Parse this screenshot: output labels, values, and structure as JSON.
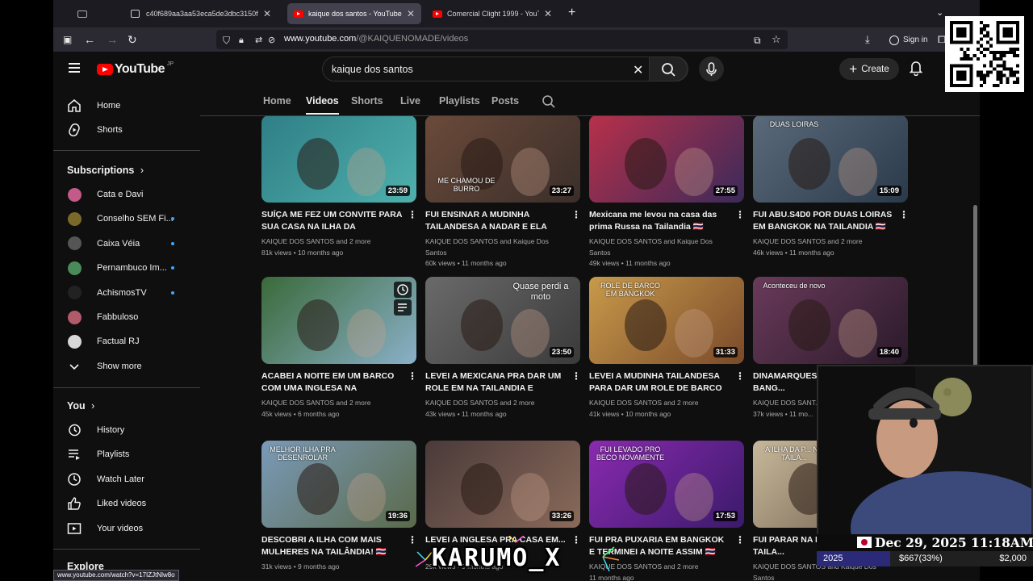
{
  "browser": {
    "tabs": [
      {
        "label": "c40f689aa3aa53eca5de3dbc3150f",
        "active": false
      },
      {
        "label": "kaique dos santos - YouTube",
        "active": true
      },
      {
        "label": "Comercial Clight 1999 - YouTub",
        "active": false
      }
    ],
    "url_domain": "www.youtube.com",
    "url_path": "/@KAIQUENOMADE/videos",
    "sign_in": "Sign in",
    "status_url": "www.youtube.com/watch?v=17IZJtNlw8o"
  },
  "youtube": {
    "logo": "YouTube",
    "region": "JP",
    "search_query": "kaique dos santos",
    "create_label": "Create"
  },
  "sidebar": {
    "main": [
      {
        "label": "Home",
        "icon": "home-icon"
      },
      {
        "label": "Shorts",
        "icon": "shorts-icon"
      }
    ],
    "subscriptions_title": "Subscriptions",
    "subscriptions": [
      {
        "label": "Cata e Davi",
        "color": "#c45a8a",
        "new": false
      },
      {
        "label": "Conselho SEM Fi...",
        "color": "#7a6a2a",
        "new": true
      },
      {
        "label": "Caixa Véia",
        "color": "#555555",
        "new": true
      },
      {
        "label": "Pernambuco Im...",
        "color": "#4a8a5a",
        "new": true
      },
      {
        "label": "AchismosTV",
        "color": "#222222",
        "new": true
      },
      {
        "label": "Fabbuloso",
        "color": "#b05a6a",
        "new": false
      },
      {
        "label": "Factual RJ",
        "color": "#d8d8d8",
        "new": false
      }
    ],
    "show_more": "Show more",
    "you_title": "You",
    "you": [
      {
        "label": "History",
        "icon": "history-icon"
      },
      {
        "label": "Playlists",
        "icon": "playlists-icon"
      },
      {
        "label": "Watch Later",
        "icon": "watch-later-icon"
      },
      {
        "label": "Liked videos",
        "icon": "liked-icon"
      },
      {
        "label": "Your videos",
        "icon": "your-videos-icon"
      }
    ],
    "explore_title": "Explore"
  },
  "channel_tabs": [
    "Home",
    "Videos",
    "Shorts",
    "Live",
    "Playlists",
    "Posts"
  ],
  "active_tab": "Videos",
  "videos": [
    {
      "title": "SUÍÇA ME FEZ UM CONVITE PARA SUA CASA NA ILHA DA TAILÂNDI...",
      "author": "KAIQUE DOS SANTOS and 2 more",
      "views": "81k views",
      "age": "10 months ago",
      "duration": "23:59",
      "overlay": "",
      "colors": [
        "#2f7f86",
        "#4fb0ad"
      ]
    },
    {
      "title": "FUI ENSINAR A MUDINHA TAILANDESA A NADAR E ELA FEZ...",
      "author": "KAIQUE DOS SANTOS and Kaique Dos Santos",
      "views": "60k views",
      "age": "11 months ago",
      "duration": "23:27",
      "overlay": "ME CHAMOU DE BURRO",
      "colors": [
        "#6b4a3a",
        "#3a2e2a"
      ]
    },
    {
      "title": "Mexicana me levou na casa das prima Russa na Tailandia 🇹🇭",
      "author": "KAIQUE DOS SANTOS and Kaique Dos Santos",
      "views": "49k views",
      "age": "11 months ago",
      "duration": "27:55",
      "overlay": "",
      "colors": [
        "#b8304a",
        "#3a2a5a"
      ]
    },
    {
      "title": "FUI ABU.S4D0 POR DUAS LOIRAS EM BANGKOK NA TAILANDIA 🇹🇭",
      "author": "KAIQUE DOS SANTOS and 2 more",
      "views": "46k views",
      "age": "11 months ago",
      "duration": "15:09",
      "overlay": "DUAS LOIRAS",
      "colors": [
        "#5a6a7a",
        "#2a3a4a"
      ]
    },
    {
      "title": "ACABEI A NOITE EM UM BARCO COM UMA INGLESA NA TAILANDI...",
      "author": "KAIQUE DOS SANTOS and 2 more",
      "views": "45k views",
      "age": "6 months ago",
      "duration": "",
      "overlay": "",
      "colors": [
        "#3a6a3a",
        "#8ab0c8"
      ]
    },
    {
      "title": "LEVEI A MEXICANA PRA DAR UM ROLE EM NA TAILANDIA E QUASE...",
      "author": "KAIQUE DOS SANTOS and 2 more",
      "views": "43k views",
      "age": "11 months ago",
      "duration": "23:50",
      "overlay": "Quase perdi a moto",
      "colors": [
        "#6a6a6a",
        "#3a3a3a"
      ]
    },
    {
      "title": "LEVEI A MUDINHA TAILANDESA PARA DAR UM ROLE DE BARCO E...",
      "author": "KAIQUE DOS SANTOS and 2 more",
      "views": "41k views",
      "age": "10 months ago",
      "duration": "31:33",
      "overlay": "ROLE DE BARCO EM BANGKOK",
      "colors": [
        "#c89a4a",
        "#7a4a2a"
      ]
    },
    {
      "title": "DINAMARQUES... CASA EM BANG...",
      "author": "KAIQUE DOS SANT...",
      "views": "37k views",
      "age": "11 mo...",
      "duration": "18:40",
      "overlay": "Aconteceu de novo",
      "colors": [
        "#6a3a5a",
        "#2a1a2a"
      ]
    },
    {
      "title": "DESCOBRI A ILHA COM MAIS MULHERES NA TAILÂNDIA! 🇹🇭",
      "author": "",
      "views": "31k views",
      "age": "9 months ago",
      "duration": "19:36",
      "overlay": "MELHOR ILHA PRA DESENROLAR",
      "colors": [
        "#7a9ab8",
        "#5a6a4a"
      ]
    },
    {
      "title": "LEVEI A INGLESA PRA CASA EM...",
      "author": "",
      "views": "29k views",
      "age": "9 months ago",
      "duration": "33:26",
      "overlay": "",
      "colors": [
        "#4a3a3a",
        "#8a6a5a"
      ]
    },
    {
      "title": "FUI PRA PUXARIA EM BANGKOK E TERMINEI A NOITE ASSIM 🇹🇭",
      "author": "KAIQUE DOS SANTOS and 2 more",
      "views": "",
      "age": "11 months ago",
      "duration": "17:53",
      "overlay": "FUI LEVADO PRO BECO NOVAMENTE",
      "colors": [
        "#8a2ab0",
        "#3a1a6a"
      ]
    },
    {
      "title": "FUI PARAR NA F... FESTA NA TAILA...",
      "author": "KAIQUE DOS SANTOS and Kaique Dos Santos",
      "views": "",
      "age": "",
      "duration": "",
      "overlay": "A ILHA DA P... NA TAILA...",
      "colors": [
        "#c8b89a",
        "#6a5a4a"
      ]
    }
  ],
  "stream": {
    "date": "Dec 29, 2025 11:18AM",
    "flag": "JP",
    "progress_label": "2025",
    "progress_value": "$667(33%)",
    "progress_goal": "$2,000",
    "progress_fraction": 0.33,
    "banner_text": "KARUMO_X"
  }
}
